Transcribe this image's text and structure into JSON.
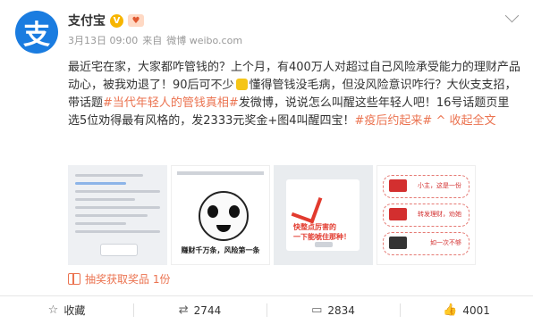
{
  "account": {
    "name": "支付宝",
    "verified_badge": "V"
  },
  "meta": {
    "date": "3月13日 09:00",
    "source_prefix": "来自",
    "source": "微博 weibo.com"
  },
  "post": {
    "p1": "最近宅在家，大家都咋管钱的？上个月，有400万人对超过自己风险承受能力的理财产品动心，被我劝退了！90后可不少",
    "p2": "懂得管钱没毛病，但没风险意识咋行？大伙支支招，带话题",
    "topic1": "#当代年轻人的管钱真相#",
    "p3": "发微博，说说怎么叫醒这些年轻人吧！16号话题页里选5位劝得最有风格的，发2333元奖金+图4叫醒四宝！",
    "topic2": "#疫后约起来#",
    "collapse": "^ 收起全文"
  },
  "images": {
    "img2_caption": "赚财千万条，风险第一条",
    "img3_text_line1": "快整点厉害的",
    "img3_text_line2": "一下能唬住那种！",
    "img4_labels": [
      "小主，这是一份",
      "转发理财，劝她",
      "如一次不够"
    ]
  },
  "reward": {
    "text": "抽奖获取奖品 1份"
  },
  "actions": {
    "favorite": "收藏",
    "repost_count": "2744",
    "comment_count": "2834",
    "like_count": "4001"
  },
  "colors": {
    "link": "#eb7350",
    "avatar_bg": "#1a7ce0"
  }
}
